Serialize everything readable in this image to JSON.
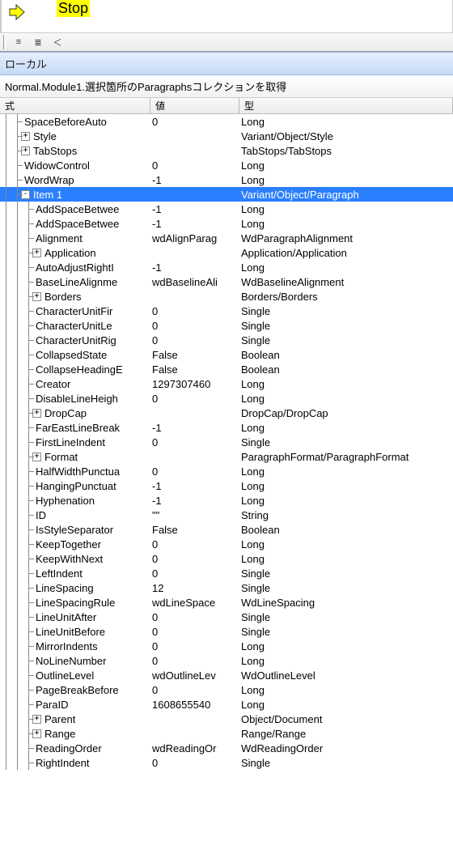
{
  "top": {
    "stop_label": "Stop"
  },
  "toolbar_buttons": [
    "≡",
    "≣",
    "＜"
  ],
  "locals_title": "ローカル",
  "context": "Normal.Module1.選択箇所のParagraphsコレクションを取得",
  "columns": {
    "expr": "式",
    "val": "値",
    "type": "型"
  },
  "rows": [
    {
      "depth": 1,
      "exp": "",
      "sel": false,
      "name": "SpaceBeforeAuto",
      "value": "0",
      "type": "Long"
    },
    {
      "depth": 1,
      "exp": "+",
      "sel": false,
      "name": "Style",
      "value": "",
      "type": "Variant/Object/Style"
    },
    {
      "depth": 1,
      "exp": "+",
      "sel": false,
      "name": "TabStops",
      "value": "",
      "type": "TabStops/TabStops"
    },
    {
      "depth": 1,
      "exp": "",
      "sel": false,
      "name": "WidowControl",
      "value": "0",
      "type": "Long"
    },
    {
      "depth": 1,
      "exp": "",
      "sel": false,
      "name": "WordWrap",
      "value": "-1",
      "type": "Long"
    },
    {
      "depth": 1,
      "exp": "-",
      "sel": true,
      "name": "Item 1",
      "value": "",
      "type": "Variant/Object/Paragraph"
    },
    {
      "depth": 2,
      "exp": "",
      "sel": false,
      "name": "AddSpaceBetwee",
      "value": "-1",
      "type": "Long"
    },
    {
      "depth": 2,
      "exp": "",
      "sel": false,
      "name": "AddSpaceBetwee",
      "value": "-1",
      "type": "Long"
    },
    {
      "depth": 2,
      "exp": "",
      "sel": false,
      "name": "Alignment",
      "value": "wdAlignParag",
      "type": "WdParagraphAlignment"
    },
    {
      "depth": 2,
      "exp": "+",
      "sel": false,
      "name": "Application",
      "value": "",
      "type": "Application/Application"
    },
    {
      "depth": 2,
      "exp": "",
      "sel": false,
      "name": "AutoAdjustRightI",
      "value": "-1",
      "type": "Long"
    },
    {
      "depth": 2,
      "exp": "",
      "sel": false,
      "name": "BaseLineAlignme",
      "value": "wdBaselineAli",
      "type": "WdBaselineAlignment"
    },
    {
      "depth": 2,
      "exp": "+",
      "sel": false,
      "name": "Borders",
      "value": "",
      "type": "Borders/Borders"
    },
    {
      "depth": 2,
      "exp": "",
      "sel": false,
      "name": "CharacterUnitFir",
      "value": "0",
      "type": "Single"
    },
    {
      "depth": 2,
      "exp": "",
      "sel": false,
      "name": "CharacterUnitLe",
      "value": "0",
      "type": "Single"
    },
    {
      "depth": 2,
      "exp": "",
      "sel": false,
      "name": "CharacterUnitRig",
      "value": "0",
      "type": "Single"
    },
    {
      "depth": 2,
      "exp": "",
      "sel": false,
      "name": "CollapsedState",
      "value": "False",
      "type": "Boolean"
    },
    {
      "depth": 2,
      "exp": "",
      "sel": false,
      "name": "CollapseHeadingE",
      "value": "False",
      "type": "Boolean"
    },
    {
      "depth": 2,
      "exp": "",
      "sel": false,
      "name": "Creator",
      "value": "1297307460",
      "type": "Long"
    },
    {
      "depth": 2,
      "exp": "",
      "sel": false,
      "name": "DisableLineHeigh",
      "value": "0",
      "type": "Long"
    },
    {
      "depth": 2,
      "exp": "+",
      "sel": false,
      "name": "DropCap",
      "value": "",
      "type": "DropCap/DropCap"
    },
    {
      "depth": 2,
      "exp": "",
      "sel": false,
      "name": "FarEastLineBreak",
      "value": "-1",
      "type": "Long"
    },
    {
      "depth": 2,
      "exp": "",
      "sel": false,
      "name": "FirstLineIndent",
      "value": "0",
      "type": "Single"
    },
    {
      "depth": 2,
      "exp": "+",
      "sel": false,
      "name": "Format",
      "value": "",
      "type": "ParagraphFormat/ParagraphFormat"
    },
    {
      "depth": 2,
      "exp": "",
      "sel": false,
      "name": "HalfWidthPunctua",
      "value": "0",
      "type": "Long"
    },
    {
      "depth": 2,
      "exp": "",
      "sel": false,
      "name": "HangingPunctuat",
      "value": "-1",
      "type": "Long"
    },
    {
      "depth": 2,
      "exp": "",
      "sel": false,
      "name": "Hyphenation",
      "value": "-1",
      "type": "Long"
    },
    {
      "depth": 2,
      "exp": "",
      "sel": false,
      "name": "ID",
      "value": "\"\"",
      "type": "String"
    },
    {
      "depth": 2,
      "exp": "",
      "sel": false,
      "name": "IsStyleSeparator",
      "value": "False",
      "type": "Boolean"
    },
    {
      "depth": 2,
      "exp": "",
      "sel": false,
      "name": "KeepTogether",
      "value": "0",
      "type": "Long"
    },
    {
      "depth": 2,
      "exp": "",
      "sel": false,
      "name": "KeepWithNext",
      "value": "0",
      "type": "Long"
    },
    {
      "depth": 2,
      "exp": "",
      "sel": false,
      "name": "LeftIndent",
      "value": "0",
      "type": "Single"
    },
    {
      "depth": 2,
      "exp": "",
      "sel": false,
      "name": "LineSpacing",
      "value": "12",
      "type": "Single"
    },
    {
      "depth": 2,
      "exp": "",
      "sel": false,
      "name": "LineSpacingRule",
      "value": "wdLineSpace",
      "type": "WdLineSpacing"
    },
    {
      "depth": 2,
      "exp": "",
      "sel": false,
      "name": "LineUnitAfter",
      "value": "0",
      "type": "Single"
    },
    {
      "depth": 2,
      "exp": "",
      "sel": false,
      "name": "LineUnitBefore",
      "value": "0",
      "type": "Single"
    },
    {
      "depth": 2,
      "exp": "",
      "sel": false,
      "name": "MirrorIndents",
      "value": "0",
      "type": "Long"
    },
    {
      "depth": 2,
      "exp": "",
      "sel": false,
      "name": "NoLineNumber",
      "value": "0",
      "type": "Long"
    },
    {
      "depth": 2,
      "exp": "",
      "sel": false,
      "name": "OutlineLevel",
      "value": "wdOutlineLev",
      "type": "WdOutlineLevel"
    },
    {
      "depth": 2,
      "exp": "",
      "sel": false,
      "name": "PageBreakBefore",
      "value": "0",
      "type": "Long"
    },
    {
      "depth": 2,
      "exp": "",
      "sel": false,
      "name": "ParaID",
      "value": "1608655540",
      "type": "Long"
    },
    {
      "depth": 2,
      "exp": "+",
      "sel": false,
      "name": "Parent",
      "value": "",
      "type": "Object/Document"
    },
    {
      "depth": 2,
      "exp": "+",
      "sel": false,
      "name": "Range",
      "value": "",
      "type": "Range/Range"
    },
    {
      "depth": 2,
      "exp": "",
      "sel": false,
      "name": "ReadingOrder",
      "value": "wdReadingOr",
      "type": "WdReadingOrder"
    },
    {
      "depth": 2,
      "exp": "",
      "sel": false,
      "name": "RightIndent",
      "value": "0",
      "type": "Single"
    }
  ]
}
